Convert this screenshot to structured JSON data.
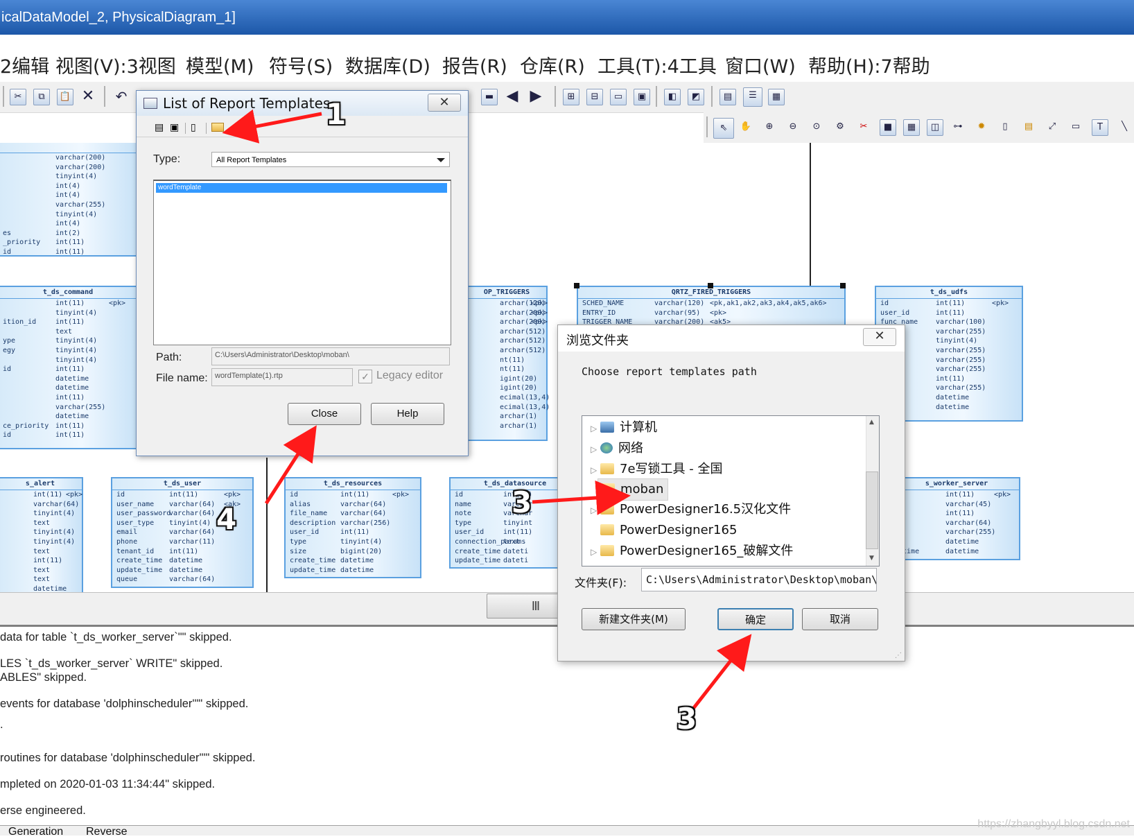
{
  "window": {
    "title": "icalDataModel_2, PhysicalDiagram_1]"
  },
  "menu": [
    {
      "label": "2编辑"
    },
    {
      "label": "视图(V):3视图"
    },
    {
      "label": "模型(M)"
    },
    {
      "label": "符号(S)"
    },
    {
      "label": "数据库(D)"
    },
    {
      "label": "报告(R)"
    },
    {
      "label": "仓库(R)"
    },
    {
      "label": "工具(T):4工具"
    },
    {
      "label": "窗口(W)"
    },
    {
      "label": "帮助(H):7帮助"
    }
  ],
  "toolbar_icons": [
    "cut-icon",
    "copy-icon",
    "paste-icon",
    "delete-icon",
    "undo-icon",
    "redo-icon",
    "find-icon",
    "print-icon",
    "zoom-icon",
    "grid-icon",
    "check-icon",
    "generate-icon",
    "back-icon",
    "forward-icon",
    "diagram-icon",
    "table-icon",
    "view-icon",
    "reference-icon",
    "domain-icon",
    "procedure-icon",
    "report-icon",
    "browser-icon",
    "output-icon"
  ],
  "palette_icons": [
    "pointer-icon",
    "hand-icon",
    "zoom-in-icon",
    "zoom-out-icon",
    "zoom-fit-icon",
    "properties-icon",
    "delete-icon",
    "package-icon",
    "table-icon",
    "view-icon",
    "reference-icon",
    "procedure-icon",
    "file-icon",
    "note-icon",
    "link-icon",
    "line-icon",
    "text-icon",
    "slash-icon"
  ],
  "diagram": {
    "tables": [
      {
        "name": "",
        "rows": [
          {
            "col": "",
            "type": "varchar(200)",
            "key": ""
          },
          {
            "col": "",
            "type": "varchar(200)",
            "key": ""
          },
          {
            "col": "",
            "type": "tinyint(4)",
            "key": ""
          },
          {
            "col": "",
            "type": "int(4)",
            "key": ""
          },
          {
            "col": "",
            "type": "int(4)",
            "key": ""
          },
          {
            "col": "",
            "type": "varchar(255)",
            "key": ""
          },
          {
            "col": "",
            "type": "tinyint(4)",
            "key": ""
          },
          {
            "col": "",
            "type": "int(4)",
            "key": ""
          },
          {
            "col": "es",
            "type": "int(2)",
            "key": ""
          },
          {
            "col": "_priority",
            "type": "int(11)",
            "key": ""
          },
          {
            "col": "id",
            "type": "int(11)",
            "key": ""
          }
        ]
      },
      {
        "name": "t_ds_command",
        "rows": [
          {
            "col": "",
            "type": "int(11)",
            "key": "<pk>"
          },
          {
            "col": "",
            "type": "tinyint(4)",
            "key": ""
          },
          {
            "col": "ition_id",
            "type": "int(11)",
            "key": ""
          },
          {
            "col": "",
            "type": "text",
            "key": ""
          },
          {
            "col": "ype",
            "type": "tinyint(4)",
            "key": ""
          },
          {
            "col": "egy",
            "type": "tinyint(4)",
            "key": ""
          },
          {
            "col": "",
            "type": "tinyint(4)",
            "key": ""
          },
          {
            "col": "id",
            "type": "int(11)",
            "key": ""
          },
          {
            "col": "",
            "type": "datetime",
            "key": ""
          },
          {
            "col": "",
            "type": "datetime",
            "key": ""
          },
          {
            "col": "",
            "type": "int(11)",
            "key": ""
          },
          {
            "col": "",
            "type": "varchar(255)",
            "key": ""
          },
          {
            "col": "",
            "type": "datetime",
            "key": ""
          },
          {
            "col": "ce_priority",
            "type": "int(11)",
            "key": ""
          },
          {
            "col": "id",
            "type": "int(11)",
            "key": ""
          }
        ]
      },
      {
        "name": "OP_TRIGGERS",
        "rows": [
          {
            "col": "",
            "type": "archar(120)",
            "key": "<pk>"
          },
          {
            "col": "",
            "type": "archar(200)",
            "key": "<pk>"
          },
          {
            "col": "",
            "type": "archar(200)",
            "key": "<pk>"
          },
          {
            "col": "",
            "type": "archar(512)",
            "key": ""
          },
          {
            "col": "",
            "type": "archar(512)",
            "key": ""
          },
          {
            "col": "",
            "type": "archar(512)",
            "key": ""
          },
          {
            "col": "",
            "type": "nt(11)",
            "key": ""
          },
          {
            "col": "",
            "type": "nt(11)",
            "key": ""
          },
          {
            "col": "",
            "type": "igint(20)",
            "key": ""
          },
          {
            "col": "",
            "type": "igint(20)",
            "key": ""
          },
          {
            "col": "",
            "type": "ecimal(13,4)",
            "key": ""
          },
          {
            "col": "",
            "type": "ecimal(13,4)",
            "key": ""
          },
          {
            "col": "",
            "type": "archar(1)",
            "key": ""
          },
          {
            "col": "",
            "type": "archar(1)",
            "key": ""
          }
        ]
      },
      {
        "name": "QRTZ_FIRED_TRIGGERS",
        "rows": [
          {
            "col": "SCHED_NAME",
            "type": "varchar(120)",
            "key": "<pk,ak1,ak2,ak3,ak4,ak5,ak6>"
          },
          {
            "col": "ENTRY_ID",
            "type": "varchar(95)",
            "key": "<pk>"
          },
          {
            "col": "TRIGGER_NAME",
            "type": "varchar(200)",
            "key": "<ak5>"
          }
        ]
      },
      {
        "name": "t_ds_udfs",
        "rows": [
          {
            "col": "id",
            "type": "int(11)",
            "key": "<pk>"
          },
          {
            "col": "user_id",
            "type": "int(11)",
            "key": ""
          },
          {
            "col": "func_name",
            "type": "varchar(100)",
            "key": ""
          },
          {
            "col": "name",
            "type": "varchar(255)",
            "key": ""
          },
          {
            "col": "",
            "type": "tinyint(4)",
            "key": ""
          },
          {
            "col": "es",
            "type": "varchar(255)",
            "key": ""
          },
          {
            "col": "e",
            "type": "varchar(255)",
            "key": ""
          },
          {
            "col": "ption",
            "type": "varchar(255)",
            "key": ""
          },
          {
            "col": "e_id",
            "type": "int(11)",
            "key": ""
          },
          {
            "col": "e_name",
            "type": "varchar(255)",
            "key": ""
          },
          {
            "col": "_time",
            "type": "datetime",
            "key": ""
          },
          {
            "col": "_time",
            "type": "datetime",
            "key": ""
          }
        ]
      },
      {
        "name": "s_alert",
        "rows": [
          {
            "col": "",
            "type": "int(11)",
            "key": "<pk>"
          },
          {
            "col": "",
            "type": "varchar(64)",
            "key": ""
          },
          {
            "col": "",
            "type": "tinyint(4)",
            "key": ""
          },
          {
            "col": "",
            "type": "text",
            "key": ""
          },
          {
            "col": "",
            "type": "tinyint(4)",
            "key": ""
          },
          {
            "col": "",
            "type": "tinyint(4)",
            "key": ""
          },
          {
            "col": "",
            "type": "text",
            "key": ""
          },
          {
            "col": "",
            "type": "int(11)",
            "key": ""
          },
          {
            "col": "",
            "type": "text",
            "key": ""
          },
          {
            "col": "",
            "type": "text",
            "key": ""
          },
          {
            "col": "",
            "type": "datetime",
            "key": ""
          }
        ]
      },
      {
        "name": "t_ds_user",
        "rows": [
          {
            "col": "id",
            "type": "int(11)",
            "key": "<pk>"
          },
          {
            "col": "user_name",
            "type": "varchar(64)",
            "key": "<ak>"
          },
          {
            "col": "user_password",
            "type": "varchar(64)",
            "key": ""
          },
          {
            "col": "user_type",
            "type": "tinyint(4)",
            "key": ""
          },
          {
            "col": "email",
            "type": "varchar(64)",
            "key": ""
          },
          {
            "col": "phone",
            "type": "varchar(11)",
            "key": ""
          },
          {
            "col": "tenant_id",
            "type": "int(11)",
            "key": ""
          },
          {
            "col": "create_time",
            "type": "datetime",
            "key": ""
          },
          {
            "col": "update_time",
            "type": "datetime",
            "key": ""
          },
          {
            "col": "queue",
            "type": "varchar(64)",
            "key": ""
          }
        ]
      },
      {
        "name": "t_ds_resources",
        "rows": [
          {
            "col": "id",
            "type": "int(11)",
            "key": "<pk>"
          },
          {
            "col": "alias",
            "type": "varchar(64)",
            "key": ""
          },
          {
            "col": "file_name",
            "type": "varchar(64)",
            "key": ""
          },
          {
            "col": "description",
            "type": "varchar(256)",
            "key": ""
          },
          {
            "col": "user_id",
            "type": "int(11)",
            "key": ""
          },
          {
            "col": "type",
            "type": "tinyint(4)",
            "key": ""
          },
          {
            "col": "size",
            "type": "bigint(20)",
            "key": ""
          },
          {
            "col": "create_time",
            "type": "datetime",
            "key": ""
          },
          {
            "col": "update_time",
            "type": "datetime",
            "key": ""
          }
        ]
      },
      {
        "name": "t_ds_datasource",
        "rows": [
          {
            "col": "id",
            "type": "int(11)",
            "key": ""
          },
          {
            "col": "name",
            "type": "varchar",
            "key": ""
          },
          {
            "col": "note",
            "type": "varchar",
            "key": ""
          },
          {
            "col": "type",
            "type": "tinyint",
            "key": ""
          },
          {
            "col": "user_id",
            "type": "int(11)",
            "key": ""
          },
          {
            "col": "connection_params",
            "type": "text",
            "key": ""
          },
          {
            "col": "create_time",
            "type": "dateti",
            "key": ""
          },
          {
            "col": "update_time",
            "type": "dateti",
            "key": ""
          }
        ]
      },
      {
        "name": "s_worker_server",
        "rows": [
          {
            "col": "",
            "type": "int(11)",
            "key": "<pk>"
          },
          {
            "col": "",
            "type": "varchar(45)",
            "key": ""
          },
          {
            "col": "",
            "type": "int(11)",
            "key": ""
          },
          {
            "col": "",
            "type": "varchar(64)",
            "key": ""
          },
          {
            "col": "",
            "type": "varchar(255)",
            "key": ""
          },
          {
            "col": "",
            "type": "datetime",
            "key": ""
          },
          {
            "col": "_time",
            "type": "datetime",
            "key": ""
          }
        ]
      }
    ]
  },
  "output": {
    "lines": [
      "data for table `t_ds_worker_server`\"\" skipped.",
      "LES `t_ds_worker_server` WRITE\" skipped.",
      "ABLES\" skipped.",
      "events for database 'dolphinscheduler'\"\" skipped.",
      ".",
      "routines for database 'dolphinscheduler'\"\" skipped.",
      "mpleted on 2020-01-03 11:34:44\" skipped.",
      "erse engineered."
    ],
    "tabs": [
      "Generation",
      "Reverse"
    ]
  },
  "watermark": "https://zhangbyyl.blog.csdn.net",
  "dialog_templates": {
    "title": "List of Report Templates",
    "close_x": "✕",
    "toolbar_icons": [
      "properties-icon",
      "delete-icon",
      "new-icon",
      "open-folder-icon"
    ],
    "type_label": "Type:",
    "type_value": "All Report Templates",
    "items": [
      "wordTemplate"
    ],
    "path_label": "Path:",
    "path_value": "C:\\Users\\Administrator\\Desktop\\moban\\",
    "filename_label": "File name:",
    "filename_value": "wordTemplate(1).rtp",
    "legacy_label": "Legacy editor",
    "legacy_checked": true,
    "close_button": "Close",
    "help_button": "Help"
  },
  "dialog_browse": {
    "title": "浏览文件夹",
    "close_x": "✕",
    "description": "Choose report templates path",
    "tree": [
      {
        "label": "计算机",
        "icon": "computer-icon",
        "expandable": true,
        "selected": false
      },
      {
        "label": "网络",
        "icon": "network-icon",
        "expandable": true,
        "selected": false
      },
      {
        "label": "7e写锁工具 - 全国",
        "icon": "folder-icon",
        "expandable": true,
        "selected": false
      },
      {
        "label": "moban",
        "icon": "folder-icon",
        "expandable": false,
        "selected": true
      },
      {
        "label": "PowerDesigner16.5汉化文件",
        "icon": "folder-icon",
        "expandable": true,
        "selected": false
      },
      {
        "label": "PowerDesigner165",
        "icon": "folder-icon",
        "expandable": false,
        "selected": false
      },
      {
        "label": "PowerDesigner165_破解文件",
        "icon": "folder-icon",
        "expandable": true,
        "selected": false
      }
    ],
    "folder_label": "文件夹(F):",
    "folder_value": "C:\\Users\\Administrator\\Desktop\\moban\\",
    "new_folder_button": "新建文件夹(M)",
    "ok_button": "确定",
    "cancel_button": "取消"
  },
  "annotations": {
    "color": "#ff1a1a",
    "markers": [
      "1",
      "3",
      "3",
      "4"
    ]
  }
}
